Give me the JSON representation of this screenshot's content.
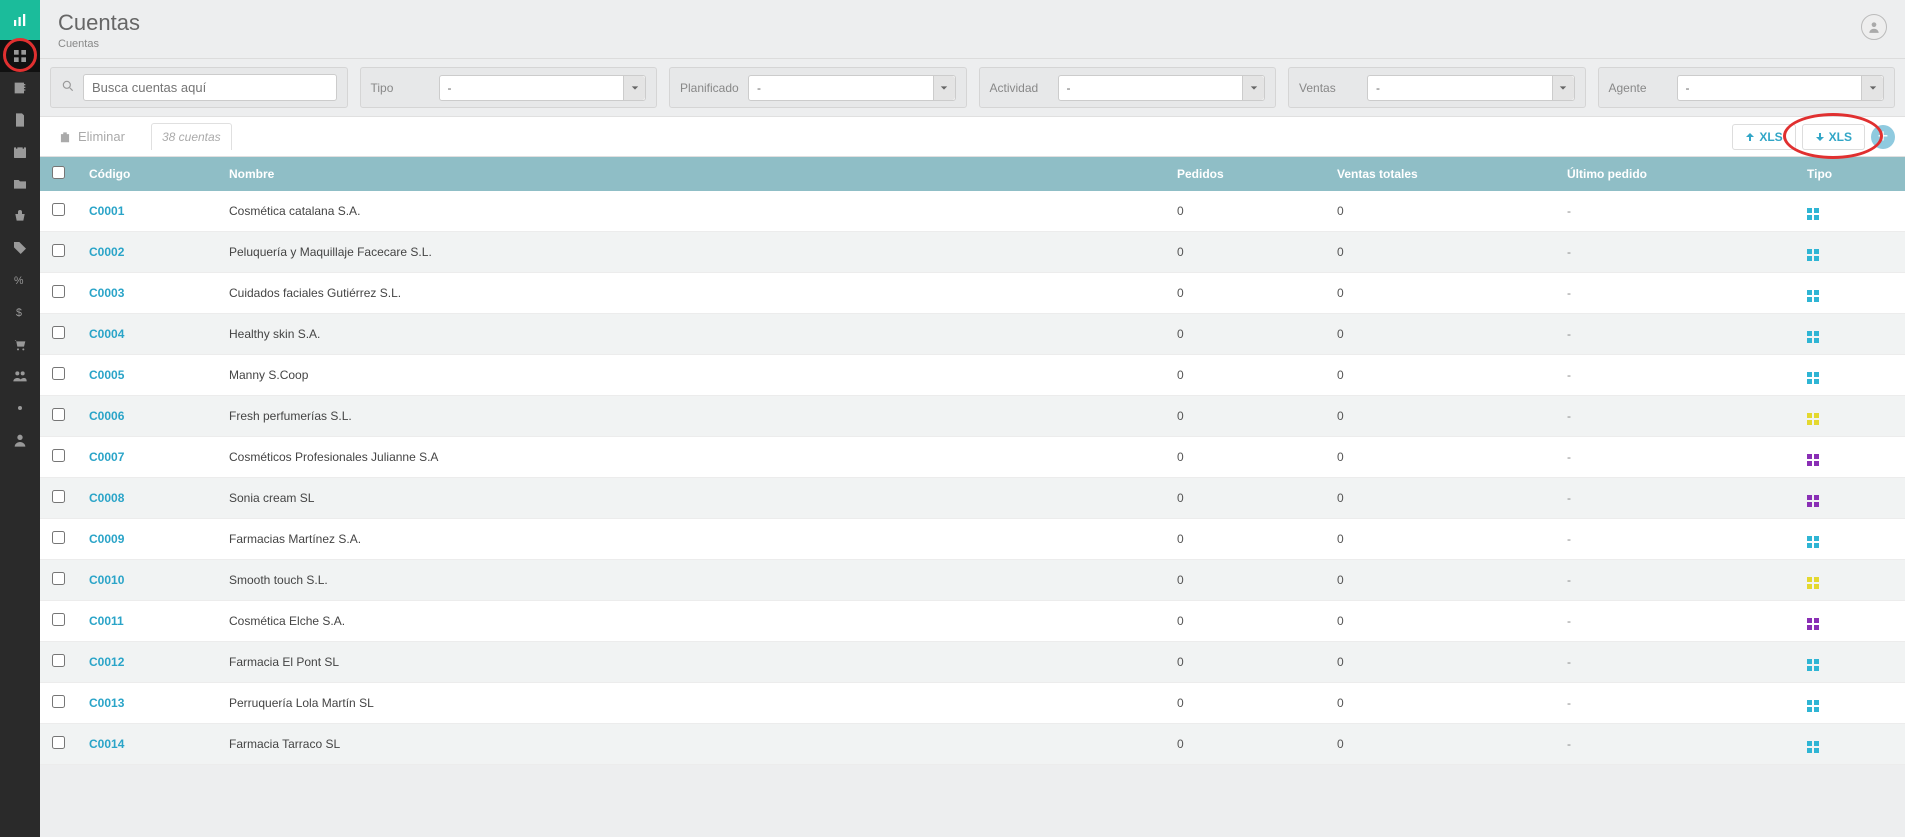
{
  "header": {
    "title": "Cuentas",
    "breadcrumb": "Cuentas"
  },
  "search": {
    "placeholder": "Busca cuentas aquí"
  },
  "filters": {
    "tipo": {
      "label": "Tipo",
      "value": "-"
    },
    "planificado": {
      "label": "Planificado",
      "value": "-"
    },
    "actividad": {
      "label": "Actividad",
      "value": "-"
    },
    "ventas": {
      "label": "Ventas",
      "value": "-"
    },
    "agente": {
      "label": "Agente",
      "value": "-"
    }
  },
  "toolbar": {
    "delete": "Eliminar",
    "count": "38 cuentas",
    "xls_up": "XLS",
    "xls_down": "XLS"
  },
  "columns": {
    "codigo": "Código",
    "nombre": "Nombre",
    "pedidos": "Pedidos",
    "ventas_totales": "Ventas totales",
    "ultimo_pedido": "Último pedido",
    "tipo": "Tipo"
  },
  "type_colors": {
    "teal": "#2fb5d4",
    "yellow": "#e4d82f",
    "purple": "#8a2fb5"
  },
  "rows": [
    {
      "code": "C0001",
      "name": "Cosmética catalana S.A.",
      "pedidos": "0",
      "ventas": "0",
      "ultimo": "-",
      "type": "teal"
    },
    {
      "code": "C0002",
      "name": "Peluquería y Maquillaje Facecare S.L.",
      "pedidos": "0",
      "ventas": "0",
      "ultimo": "-",
      "type": "teal"
    },
    {
      "code": "C0003",
      "name": "Cuidados faciales Gutiérrez S.L.",
      "pedidos": "0",
      "ventas": "0",
      "ultimo": "-",
      "type": "teal"
    },
    {
      "code": "C0004",
      "name": "Healthy skin S.A.",
      "pedidos": "0",
      "ventas": "0",
      "ultimo": "-",
      "type": "teal"
    },
    {
      "code": "C0005",
      "name": "Manny S.Coop",
      "pedidos": "0",
      "ventas": "0",
      "ultimo": "-",
      "type": "teal"
    },
    {
      "code": "C0006",
      "name": "Fresh perfumerías S.L.",
      "pedidos": "0",
      "ventas": "0",
      "ultimo": "-",
      "type": "yellow"
    },
    {
      "code": "C0007",
      "name": "Cosméticos Profesionales Julianne S.A",
      "pedidos": "0",
      "ventas": "0",
      "ultimo": "-",
      "type": "purple"
    },
    {
      "code": "C0008",
      "name": "Sonia cream SL",
      "pedidos": "0",
      "ventas": "0",
      "ultimo": "-",
      "type": "purple"
    },
    {
      "code": "C0009",
      "name": "Farmacias Martínez S.A.",
      "pedidos": "0",
      "ventas": "0",
      "ultimo": "-",
      "type": "teal"
    },
    {
      "code": "C0010",
      "name": "Smooth touch S.L.",
      "pedidos": "0",
      "ventas": "0",
      "ultimo": "-",
      "type": "yellow"
    },
    {
      "code": "C0011",
      "name": "Cosmética Elche S.A.",
      "pedidos": "0",
      "ventas": "0",
      "ultimo": "-",
      "type": "purple"
    },
    {
      "code": "C0012",
      "name": "Farmacia El Pont SL",
      "pedidos": "0",
      "ventas": "0",
      "ultimo": "-",
      "type": "teal"
    },
    {
      "code": "C0013",
      "name": "Perruquería Lola Martín SL",
      "pedidos": "0",
      "ventas": "0",
      "ultimo": "-",
      "type": "teal"
    },
    {
      "code": "C0014",
      "name": "Farmacia Tarraco SL",
      "pedidos": "0",
      "ventas": "0",
      "ultimo": "-",
      "type": "teal"
    }
  ]
}
